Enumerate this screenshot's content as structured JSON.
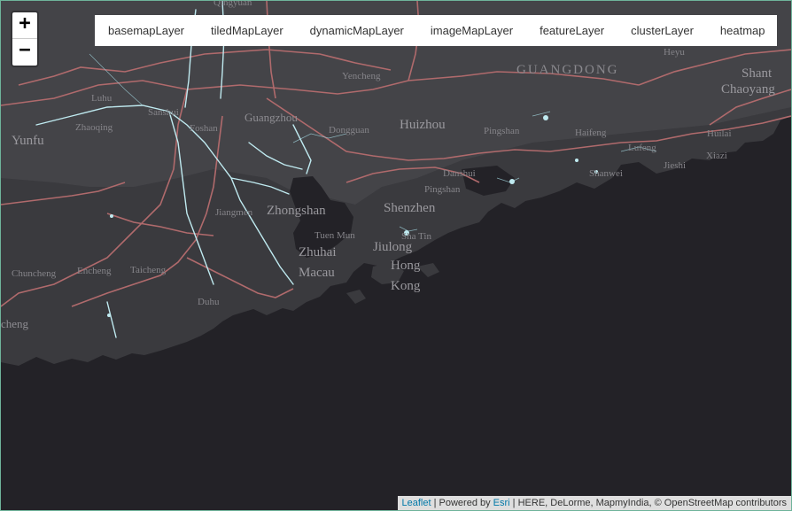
{
  "zoom_control": {
    "zoom_in": "+",
    "zoom_out": "−"
  },
  "layer_bar": {
    "items": [
      "basemapLayer",
      "tiledMapLayer",
      "dynamicMapLayer",
      "imageMapLayer",
      "featureLayer",
      "clusterLayer",
      "heatmap"
    ]
  },
  "map_labels": {
    "qingyuan": "Qingyuan",
    "guangdong": "GUANGDONG",
    "heyuan": "Heyu",
    "shantou": "Shant",
    "chaoyang": "Chaoyang",
    "yunfu": "Yunfu",
    "zhaoqing": "Zhaoqing",
    "luhu": "Luhu",
    "sanshui": "Sanshui",
    "foshan": "Foshan",
    "guangzhou": "Guangzhou",
    "dongguan": "Dongguan",
    "huizhou": "Huizhou",
    "yencheng": "Yencheng",
    "pingshan_n": "Pingshan",
    "haifeng": "Haifeng",
    "lufeng": "Lufeng",
    "shanwei": "Shanwei",
    "jieshi": "Jieshi",
    "huilai": "Huilai",
    "xiazi": "Xiazi",
    "danshui": "Danshui",
    "pingshan_s": "Pingshan",
    "shenzhen": "Shenzhen",
    "jiangmen": "Jiangmen",
    "zhongshan": "Zhongshan",
    "jiulong_st": "Jiulong",
    "tuen_mun": "Tuen Mun",
    "sha_tin": "Sha Tin",
    "zhuhai": "Zhuhai",
    "jiulong": "Jiulong",
    "hong": "Hong",
    "kong": "Kong",
    "macau": "Macau",
    "chuncheng": "Chuncheng",
    "encheng": "Encheng",
    "taicheng": "Taicheng",
    "duhu": "Duhu",
    "jiangcheng": "cheng"
  },
  "attribution": {
    "leaflet": "Leaflet",
    "powered": " | Powered by ",
    "esri": "Esri",
    "rest": " | HERE, DeLorme, MapmyIndia, © OpenStreetMap contributors"
  },
  "colors": {
    "land": "#3a3a3e",
    "sea": "#232227",
    "road": "#b06a6c",
    "river": "#bfeaf0",
    "label": "#8e8d92"
  }
}
